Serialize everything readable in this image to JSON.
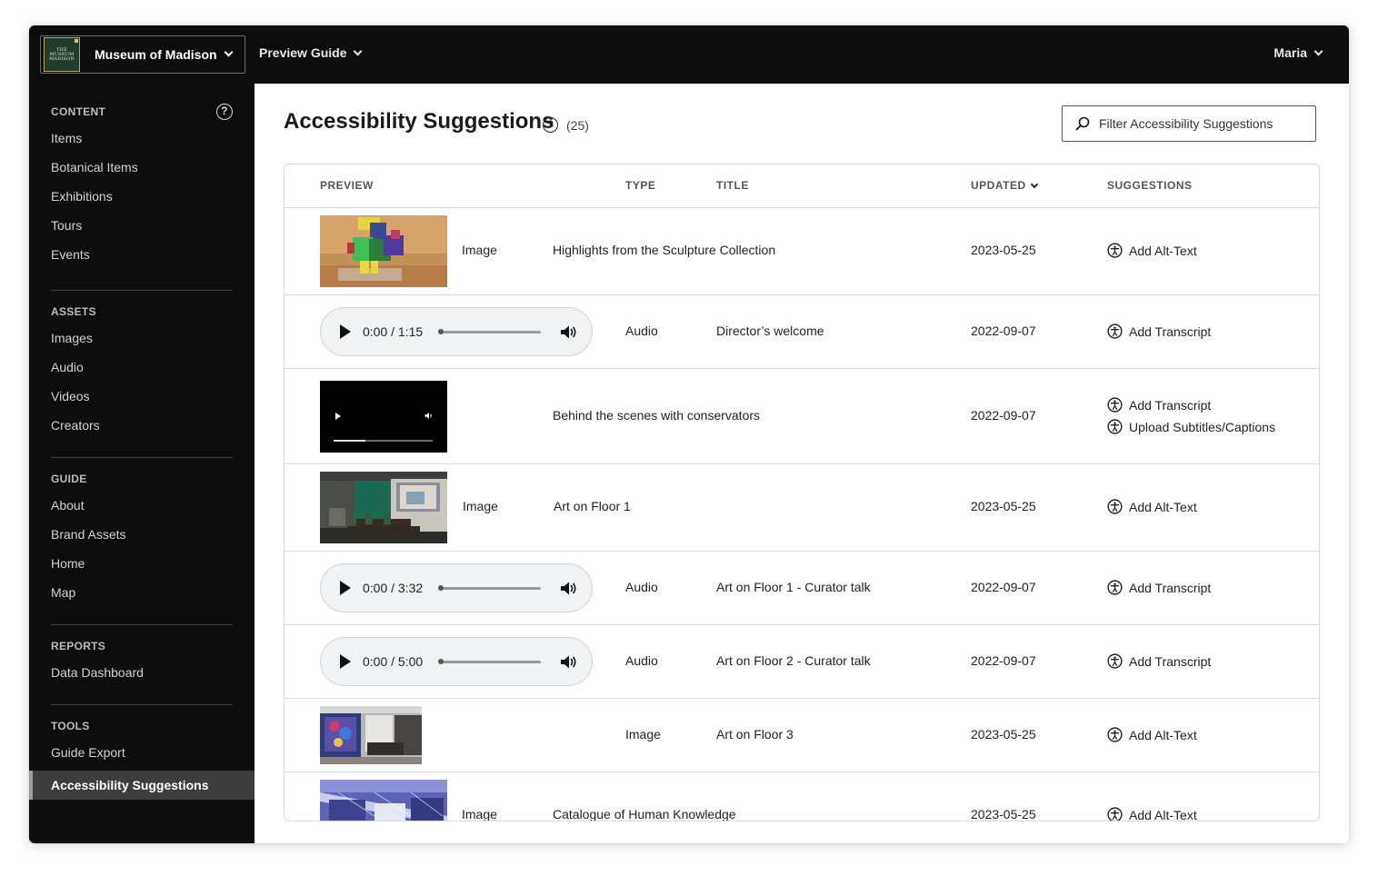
{
  "topbar": {
    "org_name": "Museum of Madison",
    "logo_text": "THE MUSEUM MADISON",
    "preview_guide": "Preview Guide",
    "user_name": "Maria"
  },
  "sidebar": {
    "content": {
      "heading": "CONTENT",
      "items": [
        "Items",
        "Botanical Items",
        "Exhibitions",
        "Tours",
        "Events"
      ]
    },
    "assets": {
      "heading": "ASSETS",
      "items": [
        "Images",
        "Audio",
        "Videos",
        "Creators"
      ]
    },
    "guide": {
      "heading": "GUIDE",
      "items": [
        "About",
        "Brand Assets",
        "Home",
        "Map"
      ]
    },
    "reports": {
      "heading": "REPORTS",
      "items": [
        "Data Dashboard"
      ]
    },
    "tools": {
      "heading": "TOOLS",
      "items": [
        "Guide Export",
        "Accessibility Suggestions"
      ]
    },
    "active_item": "Accessibility Suggestions"
  },
  "main": {
    "title": "Accessibility Suggestions",
    "count": "(25)",
    "filter_placeholder": "Filter Accessibility Suggestions",
    "columns": {
      "preview": "PREVIEW",
      "type": "TYPE",
      "title": "TITLE",
      "updated": "UPDATED",
      "suggestions": "SUGGESTIONS"
    },
    "rows": [
      {
        "preview": "sculpture-image",
        "type": "Image",
        "title": "Highlights from the Sculpture Collection",
        "updated": "2023-05-25",
        "suggestions": [
          "Add Alt-Text"
        ]
      },
      {
        "preview": "audio-player",
        "audio_time": "0:00 / 1:15",
        "type": "Audio",
        "title": "Director’s welcome",
        "updated": "2022-09-07",
        "suggestions": [
          "Add Transcript"
        ]
      },
      {
        "preview": "video-player",
        "type": "",
        "title": "Behind the scenes with conservators",
        "updated": "2022-09-07",
        "suggestions": [
          "Add Transcript",
          "Upload Subtitles/Captions"
        ]
      },
      {
        "preview": "gallery-room-image",
        "type": "Image",
        "title": "Art on Floor 1",
        "updated": "2023-05-25",
        "suggestions": [
          "Add Alt-Text"
        ]
      },
      {
        "preview": "audio-player",
        "audio_time": "0:00 / 3:32",
        "type": "Audio",
        "title": "Art on Floor 1 - Curator talk",
        "updated": "2022-09-07",
        "suggestions": [
          "Add Transcript"
        ]
      },
      {
        "preview": "audio-player",
        "audio_time": "0:00 / 5:00",
        "type": "Audio",
        "title": "Art on Floor 2 - Curator talk",
        "updated": "2022-09-07",
        "suggestions": [
          "Add Transcript"
        ]
      },
      {
        "preview": "floor3-image",
        "type": "Image",
        "title": "Art on Floor 3",
        "updated": "2023-05-25",
        "suggestions": [
          "Add Alt-Text"
        ]
      },
      {
        "preview": "library-image",
        "type": "Image",
        "title": "Catalogue of Human Knowledge",
        "updated": "2023-05-25",
        "suggestions": [
          "Add Alt-Text"
        ]
      }
    ]
  },
  "colors": {
    "topbar": "#0d0d0d",
    "sidebar": "#0d0d0d",
    "active_item_bg": "#3d3d3d",
    "border": "#dadada"
  }
}
